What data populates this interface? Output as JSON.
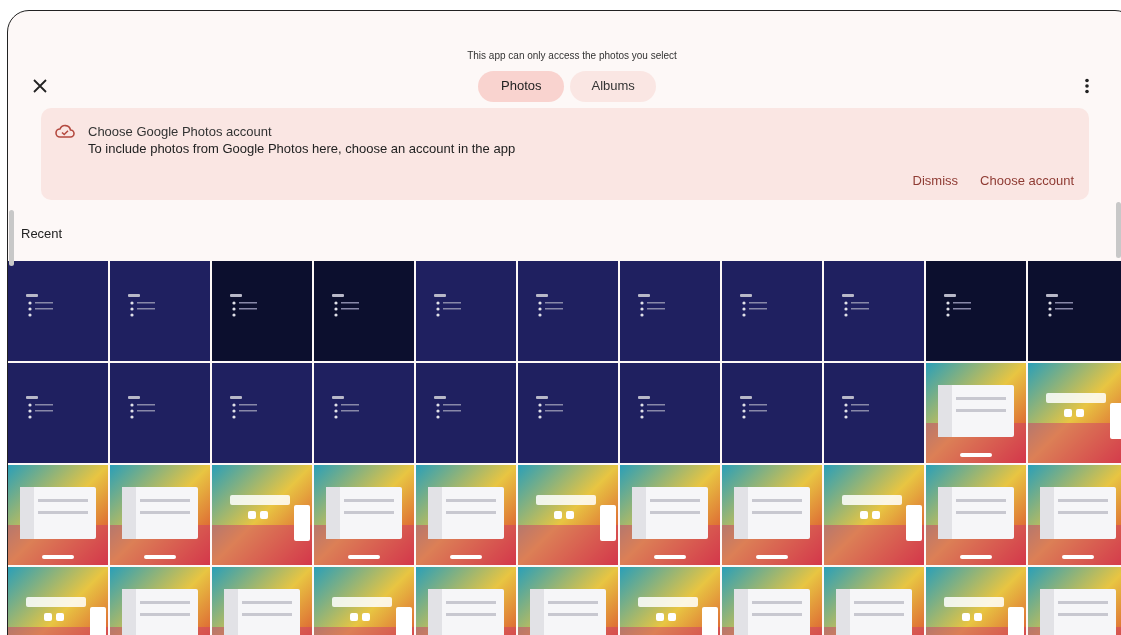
{
  "header": {
    "notice": "This app can only access the photos you select"
  },
  "tabs": [
    {
      "label": "Photos",
      "selected": true
    },
    {
      "label": "Albums",
      "selected": false
    }
  ],
  "banner": {
    "title": "Choose Google Photos account",
    "text": "To include photos from Google Photos here, choose an account in the app",
    "actions": [
      "Dismiss",
      "Choose account"
    ]
  },
  "section": {
    "title": "Recent"
  }
}
